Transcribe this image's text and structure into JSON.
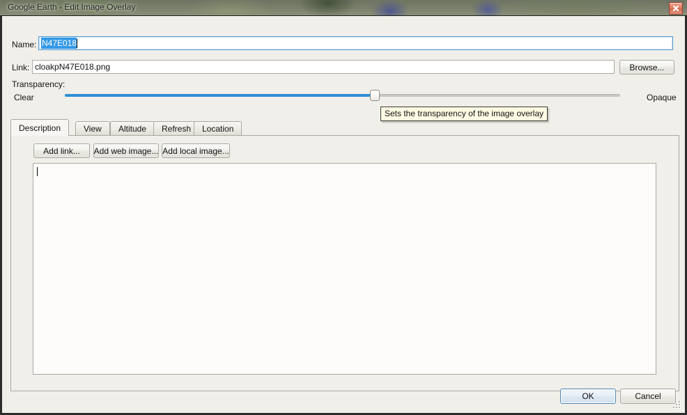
{
  "window": {
    "title": "Google Earth - Edit Image Overlay",
    "close_icon": "close-icon",
    "close_glyph": "✕"
  },
  "form": {
    "name_label": "Name:",
    "name_value": "N47E018",
    "name_selected": true,
    "link_label": "Link:",
    "link_value": "cloakpN47E018.png",
    "browse_label": "Browse...",
    "transparency_label": "Transparency:",
    "slider_min_label": "Clear",
    "slider_max_label": "Opaque",
    "slider_percent": 55
  },
  "tooltip": {
    "text": "Sets the transparency of the image overlay"
  },
  "tabs": [
    {
      "label": "Description",
      "active": true
    },
    {
      "label": "View",
      "active": false
    },
    {
      "label": "Altitude",
      "active": false
    },
    {
      "label": "Refresh",
      "active": false
    },
    {
      "label": "Location",
      "active": false
    }
  ],
  "description_tab": {
    "add_link_label": "Add link...",
    "add_web_image_label": "Add web image...",
    "add_local_image_label": "Add local image...",
    "description_value": "",
    "description_placeholder": ""
  },
  "footer": {
    "ok_label": "OK",
    "cancel_label": "Cancel"
  },
  "colors": {
    "dialog_background": "#f0efe9",
    "accent_blue": "#2e8fd4",
    "selection_blue": "#3399e6",
    "tooltip_background": "#fdfbe3",
    "close_button_red": "#cf6a4f",
    "border_gray": "#a9a8a2"
  }
}
